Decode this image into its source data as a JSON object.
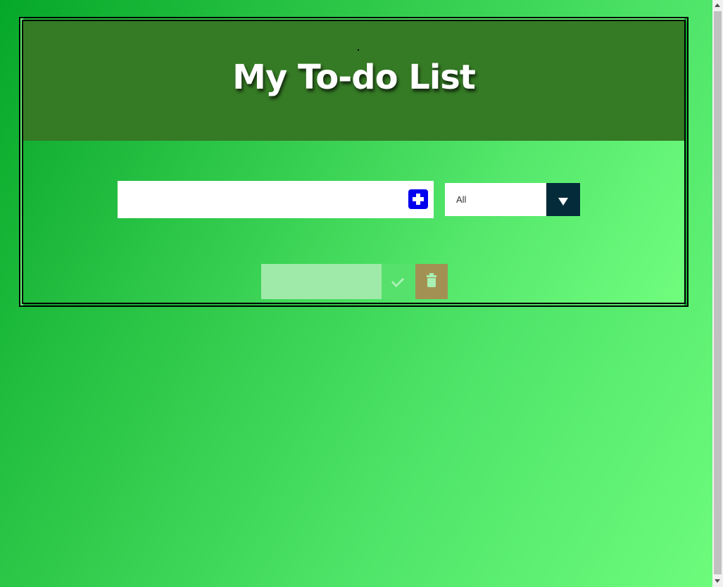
{
  "header": {
    "title": "My To-do List"
  },
  "add_form": {
    "input_value": "",
    "input_placeholder": "",
    "add_icon": "plus-square-icon"
  },
  "filter": {
    "selected": "All",
    "arrow_icon": "caret-down-icon"
  },
  "todos": [
    {
      "text": "",
      "complete_icon": "check-icon",
      "delete_icon": "trash-icon"
    }
  ],
  "colors": {
    "header_bg": "#357a25",
    "add_button": "#0000ee",
    "filter_arrow_bg": "#042b3a",
    "trash_button": "#a39153",
    "complete_button": "#56e06c"
  }
}
